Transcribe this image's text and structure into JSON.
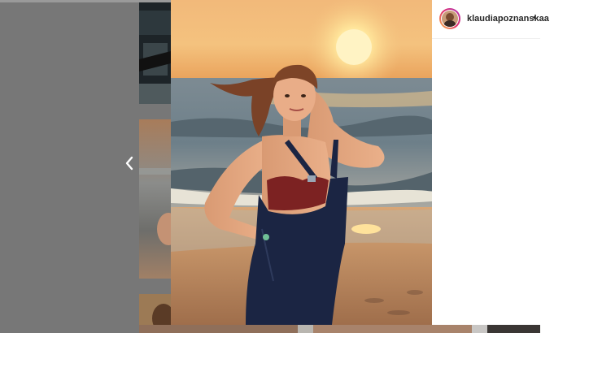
{
  "post": {
    "username": "klaudiapoznanskaa",
    "separator": "•"
  },
  "icons": {
    "prev": "chevron-left-icon"
  },
  "colors": {
    "backdrop": "#777777",
    "panel": "#ffffff",
    "text": "#262626"
  }
}
